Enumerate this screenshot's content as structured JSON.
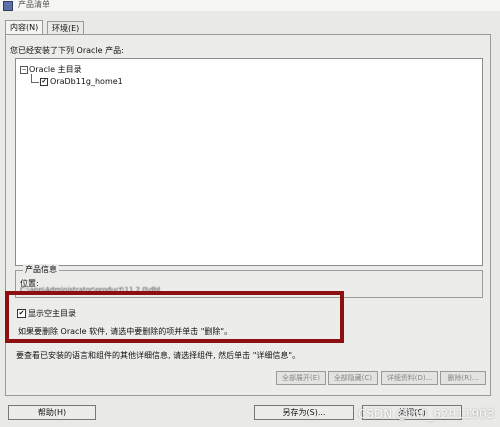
{
  "window": {
    "title": "产品清单"
  },
  "tabs": [
    {
      "label": "内容(N)",
      "active": true
    },
    {
      "label": "环境(E)",
      "active": false
    }
  ],
  "installed_label": "您已经安装了下列 Oracle 产品:",
  "tree": {
    "root": {
      "toggle": "−",
      "label": "Oracle 主目录"
    },
    "child": {
      "label": "OraDb11g_home1",
      "checked": true
    }
  },
  "product_info": {
    "title": "产品信息",
    "location_label": "位置:",
    "location_value": "C:\\app\\Administrator\\product\\11.2.0\\dbhome_1"
  },
  "show_empty_home": {
    "label": "显示空主目录",
    "checked": true
  },
  "remove_hint": "如果要删除 Oracle 软件, 请选中要删除的项并单击 \"删除\"。",
  "details_hint": "要查看已安装的语言和组件的其他详细信息, 请选择组件, 然后单击 \"详细信息\"。",
  "action_buttons": {
    "expand_all": "全部展开(E)",
    "collapse_all": "全部隐藏(C)",
    "details": "详细资料(D)...",
    "remove": "删除(R)..."
  },
  "bottom_buttons": {
    "help": "帮助(H)",
    "save_as": "另存为(S)...",
    "close": "关闭(C)"
  },
  "watermark": "CSDN @m0_62911903",
  "colors": {
    "highlight": "#8c1010",
    "dialog": "#ececea"
  }
}
